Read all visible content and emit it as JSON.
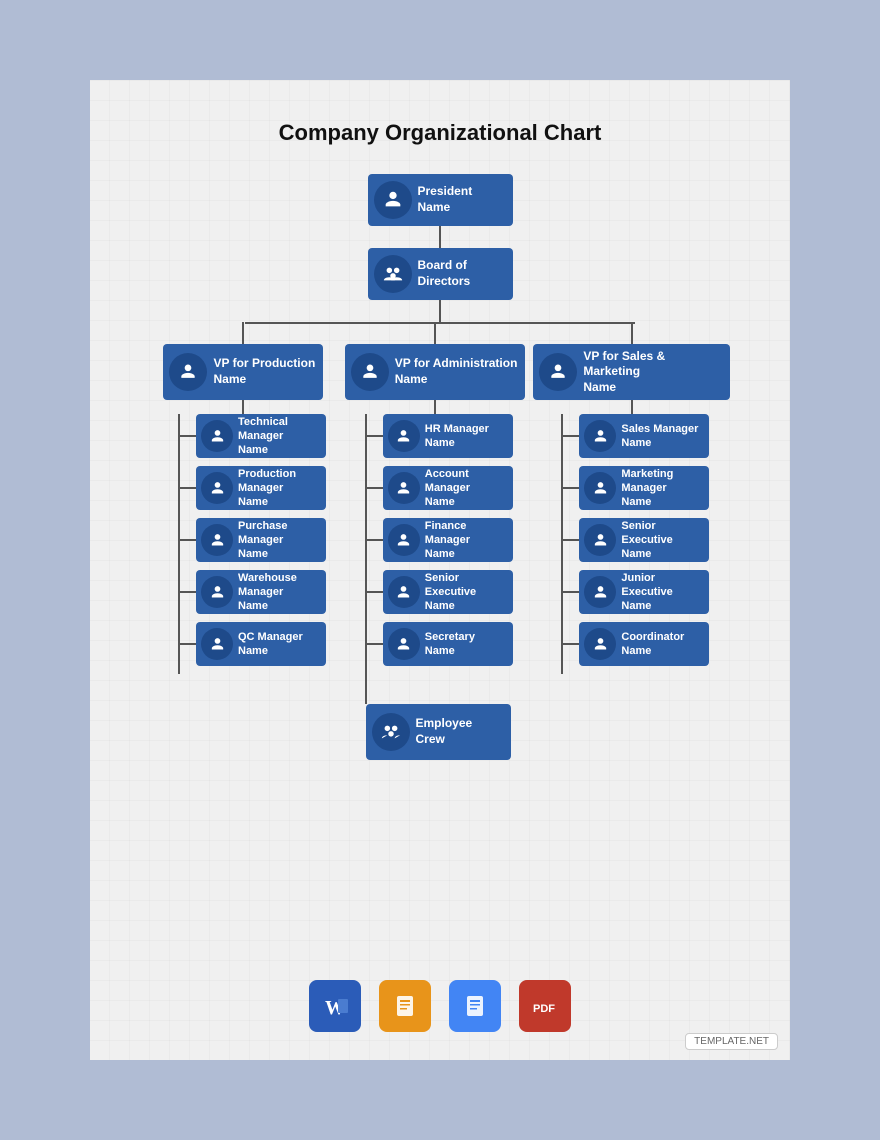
{
  "title": "Company Organizational Chart",
  "colors": {
    "node_bg": "#2d5fa6",
    "node_icon_bg": "#1e4a8a",
    "line": "#555555"
  },
  "president": {
    "role": "President",
    "name": "Name"
  },
  "board": {
    "role": "Board of",
    "role2": "Directors"
  },
  "vps": [
    {
      "role": "VP for Production",
      "name": "Name",
      "icon": "person",
      "reports": [
        {
          "role": "Technical Manager",
          "name": "Name"
        },
        {
          "role": "Production Manager",
          "name": "Name"
        },
        {
          "role": "Purchase Manager",
          "name": "Name"
        },
        {
          "role": "Warehouse Manager",
          "name": "Name"
        },
        {
          "role": "QC Manager",
          "name": "Name"
        }
      ]
    },
    {
      "role": "VP for Administration",
      "name": "Name",
      "icon": "person",
      "reports": [
        {
          "role": "HR Manager",
          "name": "Name"
        },
        {
          "role": "Account Manager",
          "name": "Name"
        },
        {
          "role": "Finance Manager",
          "name": "Name"
        },
        {
          "role": "Senior Executive",
          "name": "Name"
        },
        {
          "role": "Secretary",
          "name": "Name"
        }
      ]
    },
    {
      "role": "VP for Sales & Marketing",
      "name": "Name",
      "icon": "person",
      "reports": [
        {
          "role": "Sales Manager",
          "name": "Name"
        },
        {
          "role": "Marketing Manager",
          "name": "Name"
        },
        {
          "role": "Senior Executive",
          "name": "Name"
        },
        {
          "role": "Junior Executive",
          "name": "Name"
        },
        {
          "role": "Coordinator",
          "name": "Name"
        }
      ]
    }
  ],
  "employee": {
    "role": "Employee",
    "name": "Crew"
  },
  "icons_bar": [
    {
      "name": "Microsoft Word",
      "type": "word"
    },
    {
      "name": "Apple Pages",
      "type": "pages"
    },
    {
      "name": "Google Docs",
      "type": "gdoc"
    },
    {
      "name": "Adobe PDF",
      "type": "pdf"
    }
  ],
  "template_label": "TEMPLATE.NET"
}
